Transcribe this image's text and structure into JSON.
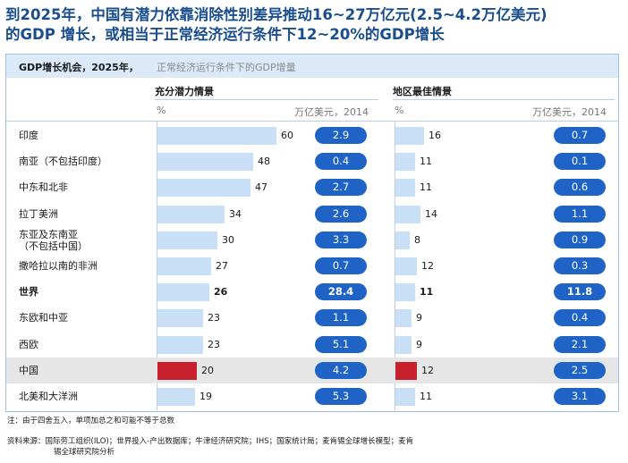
{
  "title_line1": "到2025年，中国有潜力依靠消除性别差异推动16~27万亿元(2.5~4.2万亿美元)",
  "title_line2": "的GDP 增长，或相当于正常经济运行条件下12~20%的GDP增长",
  "panel": {
    "heading": "GDP增长机会，2025年，",
    "subheading": "正常经济运行条件下的GDP增量"
  },
  "columns": {
    "left_title": "充分潜力情景",
    "right_title": "地区最佳情景",
    "pct_label": "%",
    "unit_label": "万亿美元，2014"
  },
  "colors": {
    "bar": "#c9dff6",
    "highlight_bar": "#c8202c",
    "pill": "#1f63c6",
    "title": "#1a4e8c"
  },
  "chart_data": {
    "type": "bar",
    "categories": [
      "印度",
      "南亚（不包括印度）",
      "中东和北非",
      "拉丁美洲",
      "东亚及东南亚（不包括中国）",
      "撒哈拉以南的非洲",
      "世界",
      "东欧和中亚",
      "西欧",
      "中国",
      "北美和大洋洲"
    ],
    "row_labels": [
      [
        "印度"
      ],
      [
        "南亚（不包括印度）"
      ],
      [
        "中东和北非"
      ],
      [
        "拉丁美洲"
      ],
      [
        "东亚及东南亚",
        "（不包括中国）"
      ],
      [
        "撒哈拉以南的非洲"
      ],
      [
        "世界"
      ],
      [
        "东欧和中亚"
      ],
      [
        "西欧"
      ],
      [
        "中国"
      ],
      [
        "北美和大洋洲"
      ]
    ],
    "series": [
      {
        "name": "充分潜力情景",
        "percent": [
          60,
          48,
          47,
          34,
          30,
          27,
          26,
          23,
          23,
          20,
          19
        ],
        "usd_trillion": [
          "2.9",
          "0.4",
          "2.7",
          "2.6",
          "3.3",
          "0.7",
          "28.4",
          "1.1",
          "5.1",
          "4.2",
          "5.3"
        ]
      },
      {
        "name": "地区最佳情景",
        "percent": [
          16,
          11,
          11,
          14,
          8,
          12,
          11,
          9,
          9,
          12,
          11
        ],
        "usd_trillion": [
          "0.7",
          "0.1",
          "0.6",
          "1.1",
          "0.9",
          "0.3",
          "11.8",
          "0.4",
          "2.1",
          "2.5",
          "3.1"
        ]
      }
    ],
    "bold_category": "世界",
    "highlight_category": "中国"
  },
  "notes": {
    "note": "注：由于四舍五入，单项加总之和可能不等于总数",
    "source_line1": "资料来源：国际劳工组织(ILO)；世界投入-产出数据库；牛津经济研究院；IHS；国家统计局；麦肯锡全球增长模型；麦肯",
    "source_line2": "锡全球研究院分析"
  }
}
